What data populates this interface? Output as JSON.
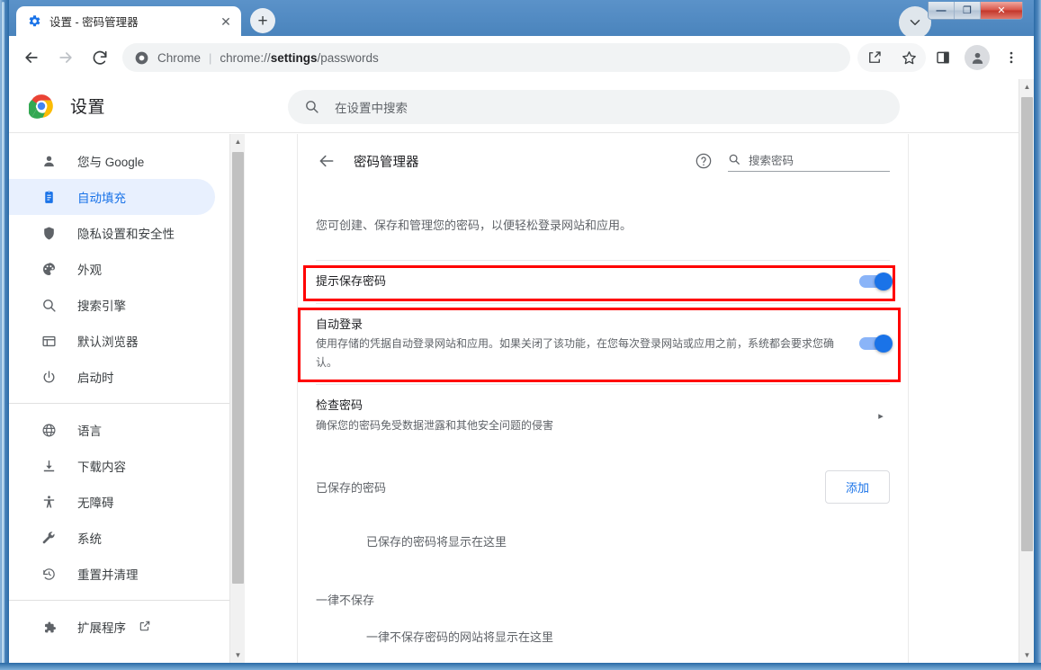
{
  "window": {
    "caption_buttons": [
      {
        "name": "minimize",
        "glyph": "—"
      },
      {
        "name": "maximize",
        "glyph": "❐"
      },
      {
        "name": "close",
        "glyph": "✕"
      }
    ]
  },
  "tabstrip": {
    "tab_title": "设置 - 密码管理器",
    "tab_favicon": "settings-gear-icon",
    "close_glyph": "✕",
    "newtab_glyph": "+",
    "profile_chevron_glyph": "⌄"
  },
  "toolbar": {
    "back_icon": "back-arrow-icon",
    "forward_icon": "forward-arrow-icon",
    "reload_icon": "reload-icon",
    "omnibox": {
      "security_icon": "chrome-logo-icon",
      "scheme_label": "Chrome",
      "separator": "|",
      "url_prefix": "chrome://",
      "url_bold": "settings",
      "url_suffix": "/passwords"
    },
    "share_icon": "share-icon",
    "bookmark_icon": "star-icon",
    "side_panel_icon": "side-panel-icon",
    "avatar_icon": "profile-avatar-icon",
    "menu_icon": "three-dot-menu-icon"
  },
  "settings_header": {
    "logo": "chrome-logo-icon",
    "title": "设置",
    "search": {
      "icon": "search-icon",
      "placeholder": "在设置中搜索"
    }
  },
  "sidebar": {
    "items": [
      {
        "label": "您与 Google",
        "icon": "person-icon",
        "active": false
      },
      {
        "label": "自动填充",
        "icon": "clipboard-icon",
        "active": true
      },
      {
        "label": "隐私设置和安全性",
        "icon": "shield-icon",
        "active": false
      },
      {
        "label": "外观",
        "icon": "palette-icon",
        "active": false
      },
      {
        "label": "搜索引擎",
        "icon": "search-icon",
        "active": false
      },
      {
        "label": "默认浏览器",
        "icon": "browser-window-icon",
        "active": false
      },
      {
        "label": "启动时",
        "icon": "power-icon",
        "active": false
      }
    ],
    "items2": [
      {
        "label": "语言",
        "icon": "globe-icon"
      },
      {
        "label": "下载内容",
        "icon": "download-icon"
      },
      {
        "label": "无障碍",
        "icon": "accessibility-icon"
      },
      {
        "label": "系统",
        "icon": "wrench-icon"
      },
      {
        "label": "重置并清理",
        "icon": "history-restore-icon"
      }
    ],
    "items3": [
      {
        "label": "扩展程序",
        "icon": "puzzle-piece-icon",
        "external_icon": "external-link-icon"
      }
    ]
  },
  "main": {
    "back_icon": "back-arrow-icon",
    "title": "密码管理器",
    "help_icon": "help-circle-icon",
    "password_search": {
      "icon": "search-icon",
      "placeholder": "搜索密码"
    },
    "intro": "您可创建、保存和管理您的密码，以便轻松登录网站和应用。",
    "rows": [
      {
        "title": "提示保存密码",
        "sub": "",
        "control": "toggle",
        "toggle_on": true,
        "highlighted": true
      },
      {
        "title": "自动登录",
        "sub": "使用存储的凭据自动登录网站和应用。如果关闭了该功能，在您每次登录网站或应用之前，系统都会要求您确认。",
        "control": "toggle",
        "toggle_on": true,
        "highlighted": true
      },
      {
        "title": "检查密码",
        "sub": "确保您的密码免受数据泄露和其他安全问题的侵害",
        "control": "chevron",
        "chevron_glyph": "▸",
        "highlighted": false
      }
    ],
    "saved_section": {
      "label": "已保存的密码",
      "add_button": "添加",
      "empty_text": "已保存的密码将显示在这里"
    },
    "never_section": {
      "label": "一律不保存",
      "empty_text": "一律不保存密码的网站将显示在这里"
    }
  },
  "colors": {
    "accent": "#1a73e8",
    "toggle_track": "#8ab4f8",
    "annotation": "#ff0000",
    "active_nav_bg": "#e8f0fe",
    "frame_blue": "#1c5a95"
  },
  "scrollbars": {
    "up_glyph": "▲",
    "down_glyph": "▼"
  }
}
